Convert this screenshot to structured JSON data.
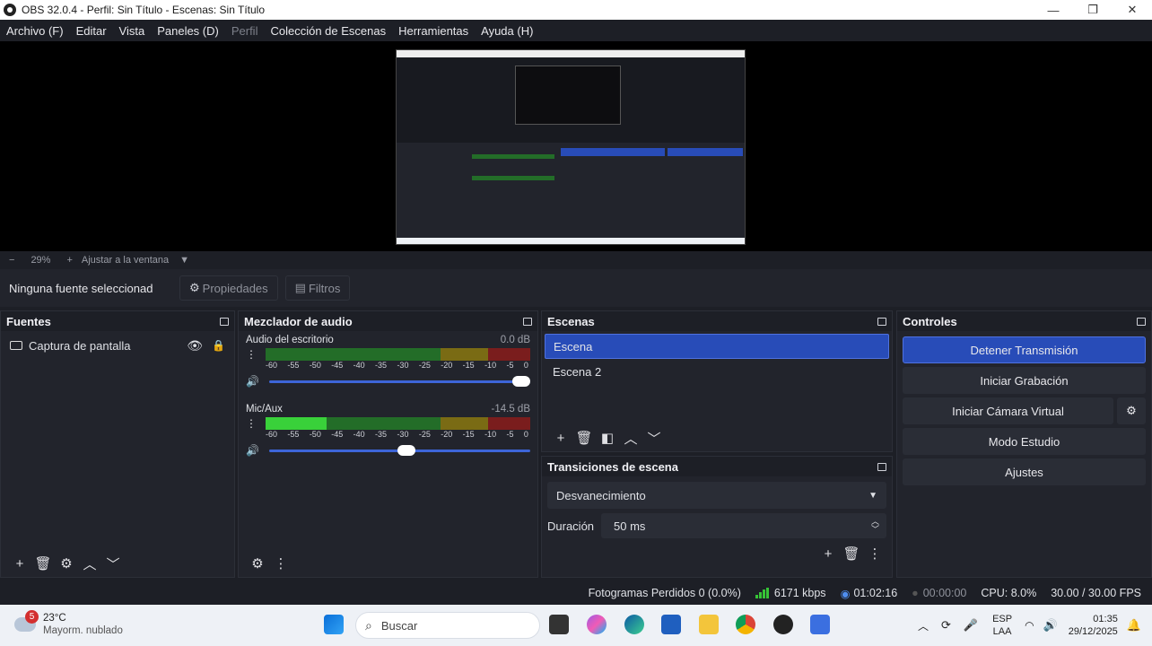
{
  "window": {
    "title": "OBS 32.0.4 - Perfil: Sin Título - Escenas: Sin Título",
    "controls": [
      "—",
      "❐",
      "✕"
    ]
  },
  "menu": [
    "Archivo (F)",
    "Editar",
    "Vista",
    "Paneles (D)",
    "Perfil",
    "Colección de Escenas",
    "Herramientas",
    "Ayuda (H)"
  ],
  "preview": {
    "zoom_minus": "−",
    "zoom": "29%",
    "zoom_plus": "+",
    "fit_label": "Ajustar a la ventana"
  },
  "source_toolbar": {
    "no_source": "Ninguna fuente seleccionad",
    "properties": "Propiedades",
    "filters": "Filtros"
  },
  "sources": {
    "title": "Fuentes",
    "items": [
      {
        "label": "Captura de pantalla"
      }
    ]
  },
  "mixer": {
    "title": "Mezclador de audio",
    "channels": [
      {
        "name": "Audio del escritorio",
        "db": "0.0 dB",
        "level_fraction": 0.0,
        "volume_fraction": 1.0
      },
      {
        "name": "Mic/Aux",
        "db": "-14.5 dB",
        "level_fraction": 0.23,
        "volume_fraction": 0.56
      }
    ],
    "ticks": [
      "-60",
      "-55",
      "-50",
      "-45",
      "-40",
      "-35",
      "-30",
      "-25",
      "-20",
      "-15",
      "-10",
      "-5",
      "0"
    ]
  },
  "scenes": {
    "title": "Escenas",
    "items": [
      {
        "label": "Escena",
        "selected": true
      },
      {
        "label": "Escena 2",
        "selected": false
      }
    ]
  },
  "transitions": {
    "title": "Transiciones de escena",
    "selected": "Desvanecimiento",
    "duration_label": "Duración",
    "duration_value": "50 ms"
  },
  "controls": {
    "title": "Controles",
    "stop_stream": "Detener Transmisión",
    "start_recording": "Iniciar Grabación",
    "start_virtual_cam": "Iniciar Cámara Virtual",
    "studio_mode": "Modo Estudio",
    "settings": "Ajustes"
  },
  "status": {
    "dropped": "Fotogramas Perdidos 0 (0.0%)",
    "bitrate": "6171 kbps",
    "stream_time": "01:02:16",
    "rec_time": "00:00:00",
    "cpu": "CPU: 8.0%",
    "fps": "30.00 / 30.00 FPS"
  },
  "taskbar": {
    "weather_badge": "5",
    "temperature": "23°C",
    "condition": "Mayorm. nublado",
    "search_placeholder": "Buscar",
    "lang_top": "ESP",
    "lang_bottom": "LAA",
    "time": "01:35",
    "date": "29/12/2025"
  },
  "colors": {
    "accent": "#284cb8",
    "meter_green": "#39d13a",
    "panel": "#22242c"
  }
}
